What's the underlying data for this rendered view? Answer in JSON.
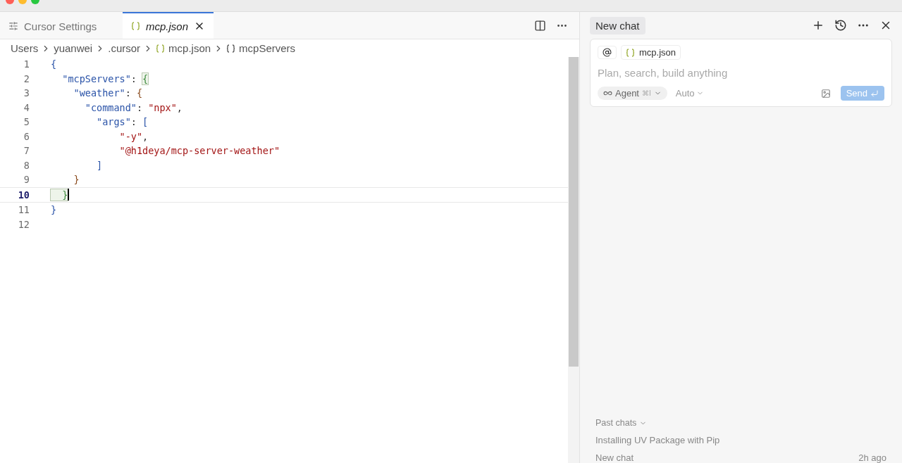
{
  "tabs": [
    {
      "label": "Cursor Settings",
      "kind": "settings",
      "selected": false
    },
    {
      "label": "mcp.json",
      "kind": "json",
      "selected": true
    }
  ],
  "breadcrumbs": [
    {
      "label": "Users",
      "kind": "folder"
    },
    {
      "label": "yuanwei",
      "kind": "folder"
    },
    {
      "label": ".cursor",
      "kind": "folder"
    },
    {
      "label": "mcp.json",
      "kind": "json"
    },
    {
      "label": "mcpServers",
      "kind": "object"
    }
  ],
  "editor": {
    "lines": [
      {
        "number": "1",
        "current": false,
        "tokens": [
          {
            "kind": "brace",
            "text": "{"
          }
        ]
      },
      {
        "number": "2",
        "current": false,
        "tokens": [
          {
            "kind": "key",
            "text": "  \"mcpServers\""
          },
          {
            "kind": "punct",
            "text": ": "
          },
          {
            "kind": "match",
            "text": "{"
          }
        ]
      },
      {
        "number": "3",
        "current": false,
        "tokens": [
          {
            "kind": "key",
            "text": "    \"weather\""
          },
          {
            "kind": "punct",
            "text": ": "
          },
          {
            "kind": "brace2",
            "text": "{"
          }
        ]
      },
      {
        "number": "4",
        "current": false,
        "tokens": [
          {
            "kind": "key",
            "text": "      \"command\""
          },
          {
            "kind": "punct",
            "text": ": "
          },
          {
            "kind": "string",
            "text": "\"npx\""
          },
          {
            "kind": "punct",
            "text": ","
          }
        ]
      },
      {
        "number": "5",
        "current": false,
        "tokens": [
          {
            "kind": "key",
            "text": "        \"args\""
          },
          {
            "kind": "punct",
            "text": ": "
          },
          {
            "kind": "brace",
            "text": "["
          }
        ]
      },
      {
        "number": "6",
        "current": false,
        "tokens": [
          {
            "kind": "string",
            "text": "            \"-y\""
          },
          {
            "kind": "punct",
            "text": ","
          }
        ]
      },
      {
        "number": "7",
        "current": false,
        "tokens": [
          {
            "kind": "string",
            "text": "            \"@h1deya/mcp-server-weather\""
          }
        ]
      },
      {
        "number": "8",
        "current": false,
        "tokens": [
          {
            "kind": "brace",
            "text": "        ]"
          }
        ]
      },
      {
        "number": "9",
        "current": false,
        "tokens": [
          {
            "kind": "brace2",
            "text": "    }"
          }
        ]
      },
      {
        "number": "10",
        "current": true,
        "tokens": [
          {
            "kind": "match",
            "text": "  }"
          }
        ]
      },
      {
        "number": "11",
        "current": false,
        "tokens": [
          {
            "kind": "brace",
            "text": "}"
          }
        ]
      },
      {
        "number": "12",
        "current": false
      }
    ]
  },
  "chat": {
    "title": "New chat",
    "context_chip": "mcp.json",
    "placeholder": "Plan, search, build anything",
    "mode": "Agent",
    "mode_shortcut": "⌘I",
    "model": "Auto",
    "send": "Send",
    "past_chats_label": "Past chats",
    "past_chats": [
      {
        "title": "Installing UV Package with Pip"
      },
      {
        "title": "New chat",
        "time": "2h ago"
      }
    ]
  }
}
